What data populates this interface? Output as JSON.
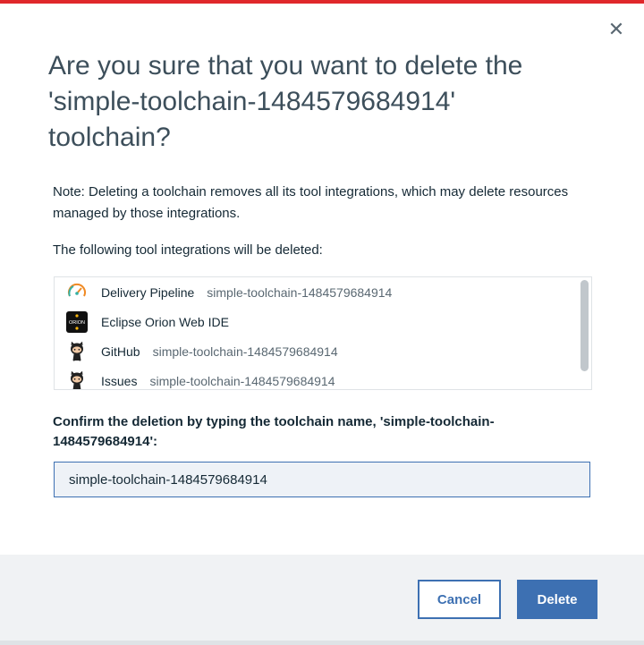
{
  "dialog": {
    "title": "Are you sure that you want to delete the 'simple-toolchain-1484579684914' toolchain?",
    "note": "Note: Deleting a toolchain removes all its tool integrations, which may delete resources managed by those integrations.",
    "following_label": "The following tool integrations will be deleted:",
    "integrations": [
      {
        "name": "Delivery Pipeline",
        "instance": "simple-toolchain-1484579684914",
        "icon": "delivery-pipeline-icon"
      },
      {
        "name": "Eclipse Orion Web IDE",
        "instance": "",
        "icon": "orion-icon"
      },
      {
        "name": "GitHub",
        "instance": "simple-toolchain-1484579684914",
        "icon": "github-icon"
      },
      {
        "name": "Issues",
        "instance": "simple-toolchain-1484579684914",
        "icon": "github-icon"
      }
    ],
    "orion_logo_text": "ORION",
    "confirm_label": "Confirm the deletion by typing the toolchain name, 'simple-toolchain-1484579684914':",
    "confirm_value": "simple-toolchain-1484579684914",
    "cancel_label": "Cancel",
    "delete_label": "Delete",
    "close_glyph": "✕"
  },
  "colors": {
    "accent": "#3d70b2",
    "top_bar": "#e0272b",
    "footer_bg": "#f0f2f4"
  }
}
